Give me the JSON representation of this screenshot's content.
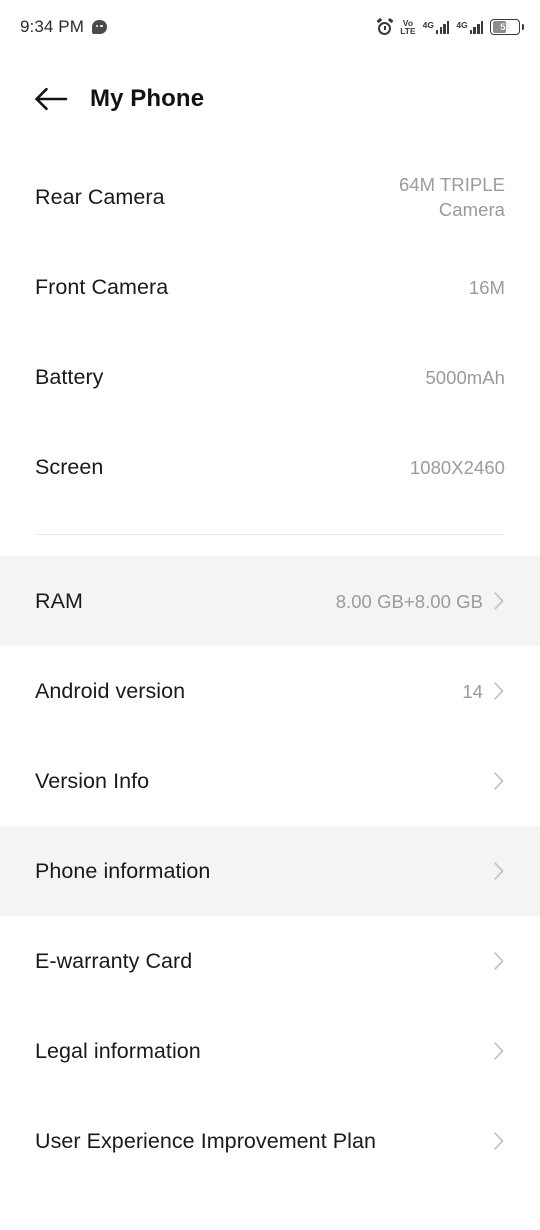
{
  "statusbar": {
    "time": "9:34 PM",
    "message_icon": "chat-bubble-icon",
    "alarm_icon": "alarm-clock-icon",
    "volte_top": "Vo",
    "volte_bottom": "LTE",
    "network_1": "4G",
    "network_2": "4G",
    "battery_percent": "52"
  },
  "appbar": {
    "back_icon": "back-arrow-icon",
    "title": "My Phone"
  },
  "list": {
    "items": [
      {
        "label": "Rear Camera",
        "value": "64M TRIPLE\nCamera",
        "chevron": false,
        "highlight": false
      },
      {
        "label": "Front Camera",
        "value": "16M",
        "chevron": false,
        "highlight": false
      },
      {
        "label": "Battery",
        "value": "5000mAh",
        "chevron": false,
        "highlight": false
      },
      {
        "label": "Screen",
        "value": "1080X2460",
        "chevron": false,
        "highlight": false
      }
    ],
    "items2": [
      {
        "label": "RAM",
        "value": "8.00 GB+8.00 GB",
        "chevron": true,
        "highlight": true
      },
      {
        "label": "Android version",
        "value": "14",
        "chevron": true,
        "highlight": false
      },
      {
        "label": "Version Info",
        "value": "",
        "chevron": true,
        "highlight": false
      },
      {
        "label": "Phone information",
        "value": "",
        "chevron": true,
        "highlight": true
      },
      {
        "label": "E-warranty Card",
        "value": "",
        "chevron": true,
        "highlight": false
      },
      {
        "label": "Legal information",
        "value": "",
        "chevron": true,
        "highlight": false
      },
      {
        "label": "User Experience Improvement Plan",
        "value": "",
        "chevron": true,
        "highlight": false
      }
    ]
  },
  "colors": {
    "background": "#ffffff",
    "highlight": "#f4f4f4",
    "label": "#1a1a1a",
    "value": "#9b9b9b",
    "divider": "#ececec",
    "chevron": "#c2c2c2"
  }
}
